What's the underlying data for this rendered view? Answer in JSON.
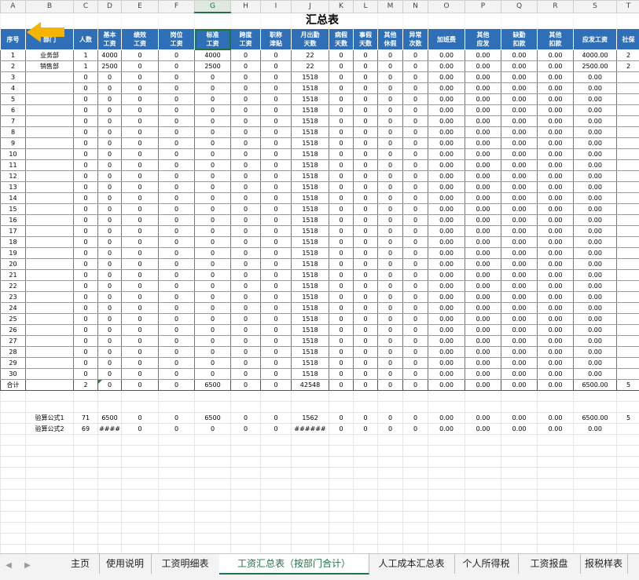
{
  "column_headers": [
    "A",
    "B",
    "C",
    "D",
    "E",
    "F",
    "G",
    "H",
    "I",
    "J",
    "K",
    "L",
    "M",
    "N",
    "O",
    "P",
    "Q",
    "R",
    "S",
    "T"
  ],
  "selected_column": "G",
  "sheet_title": "汇总表",
  "table_headers": [
    "序号",
    "部门",
    "人数",
    "基本\n工资",
    "绩效\n工资",
    "岗位\n工资",
    "标准\n工资",
    "跨度\n工资",
    "职称\n津贴",
    "月出勤\n天数",
    "病假\n天数",
    "事假\n天数",
    "其他\n休假",
    "异常\n次数",
    "加班费",
    "其他\n应发",
    "缺勤\n扣款",
    "其他\n扣款",
    "应发工资",
    "社保"
  ],
  "rows": [
    [
      "1",
      "业务部",
      "1",
      "4000",
      "0",
      "0",
      "4000",
      "0",
      "0",
      "22",
      "0",
      "0",
      "0",
      "0",
      "0.00",
      "0.00",
      "0.00",
      "0.00",
      "4000.00",
      "2"
    ],
    [
      "2",
      "销售部",
      "1",
      "2500",
      "0",
      "0",
      "2500",
      "0",
      "0",
      "22",
      "0",
      "0",
      "0",
      "0",
      "0.00",
      "0.00",
      "0.00",
      "0.00",
      "2500.00",
      "2"
    ],
    [
      "3",
      "",
      "0",
      "0",
      "0",
      "0",
      "0",
      "0",
      "0",
      "1518",
      "0",
      "0",
      "0",
      "0",
      "0.00",
      "0.00",
      "0.00",
      "0.00",
      "0.00",
      ""
    ],
    [
      "4",
      "",
      "0",
      "0",
      "0",
      "0",
      "0",
      "0",
      "0",
      "1518",
      "0",
      "0",
      "0",
      "0",
      "0.00",
      "0.00",
      "0.00",
      "0.00",
      "0.00",
      ""
    ],
    [
      "5",
      "",
      "0",
      "0",
      "0",
      "0",
      "0",
      "0",
      "0",
      "1518",
      "0",
      "0",
      "0",
      "0",
      "0.00",
      "0.00",
      "0.00",
      "0.00",
      "0.00",
      ""
    ],
    [
      "6",
      "",
      "0",
      "0",
      "0",
      "0",
      "0",
      "0",
      "0",
      "1518",
      "0",
      "0",
      "0",
      "0",
      "0.00",
      "0.00",
      "0.00",
      "0.00",
      "0.00",
      ""
    ],
    [
      "7",
      "",
      "0",
      "0",
      "0",
      "0",
      "0",
      "0",
      "0",
      "1518",
      "0",
      "0",
      "0",
      "0",
      "0.00",
      "0.00",
      "0.00",
      "0.00",
      "0.00",
      ""
    ],
    [
      "8",
      "",
      "0",
      "0",
      "0",
      "0",
      "0",
      "0",
      "0",
      "1518",
      "0",
      "0",
      "0",
      "0",
      "0.00",
      "0.00",
      "0.00",
      "0.00",
      "0.00",
      ""
    ],
    [
      "9",
      "",
      "0",
      "0",
      "0",
      "0",
      "0",
      "0",
      "0",
      "1518",
      "0",
      "0",
      "0",
      "0",
      "0.00",
      "0.00",
      "0.00",
      "0.00",
      "0.00",
      ""
    ],
    [
      "10",
      "",
      "0",
      "0",
      "0",
      "0",
      "0",
      "0",
      "0",
      "1518",
      "0",
      "0",
      "0",
      "0",
      "0.00",
      "0.00",
      "0.00",
      "0.00",
      "0.00",
      ""
    ],
    [
      "11",
      "",
      "0",
      "0",
      "0",
      "0",
      "0",
      "0",
      "0",
      "1518",
      "0",
      "0",
      "0",
      "0",
      "0.00",
      "0.00",
      "0.00",
      "0.00",
      "0.00",
      ""
    ],
    [
      "12",
      "",
      "0",
      "0",
      "0",
      "0",
      "0",
      "0",
      "0",
      "1518",
      "0",
      "0",
      "0",
      "0",
      "0.00",
      "0.00",
      "0.00",
      "0.00",
      "0.00",
      ""
    ],
    [
      "13",
      "",
      "0",
      "0",
      "0",
      "0",
      "0",
      "0",
      "0",
      "1518",
      "0",
      "0",
      "0",
      "0",
      "0.00",
      "0.00",
      "0.00",
      "0.00",
      "0.00",
      ""
    ],
    [
      "14",
      "",
      "0",
      "0",
      "0",
      "0",
      "0",
      "0",
      "0",
      "1518",
      "0",
      "0",
      "0",
      "0",
      "0.00",
      "0.00",
      "0.00",
      "0.00",
      "0.00",
      ""
    ],
    [
      "15",
      "",
      "0",
      "0",
      "0",
      "0",
      "0",
      "0",
      "0",
      "1518",
      "0",
      "0",
      "0",
      "0",
      "0.00",
      "0.00",
      "0.00",
      "0.00",
      "0.00",
      ""
    ],
    [
      "16",
      "",
      "0",
      "0",
      "0",
      "0",
      "0",
      "0",
      "0",
      "1518",
      "0",
      "0",
      "0",
      "0",
      "0.00",
      "0.00",
      "0.00",
      "0.00",
      "0.00",
      ""
    ],
    [
      "17",
      "",
      "0",
      "0",
      "0",
      "0",
      "0",
      "0",
      "0",
      "1518",
      "0",
      "0",
      "0",
      "0",
      "0.00",
      "0.00",
      "0.00",
      "0.00",
      "0.00",
      ""
    ],
    [
      "18",
      "",
      "0",
      "0",
      "0",
      "0",
      "0",
      "0",
      "0",
      "1518",
      "0",
      "0",
      "0",
      "0",
      "0.00",
      "0.00",
      "0.00",
      "0.00",
      "0.00",
      ""
    ],
    [
      "19",
      "",
      "0",
      "0",
      "0",
      "0",
      "0",
      "0",
      "0",
      "1518",
      "0",
      "0",
      "0",
      "0",
      "0.00",
      "0.00",
      "0.00",
      "0.00",
      "0.00",
      ""
    ],
    [
      "20",
      "",
      "0",
      "0",
      "0",
      "0",
      "0",
      "0",
      "0",
      "1518",
      "0",
      "0",
      "0",
      "0",
      "0.00",
      "0.00",
      "0.00",
      "0.00",
      "0.00",
      ""
    ],
    [
      "21",
      "",
      "0",
      "0",
      "0",
      "0",
      "0",
      "0",
      "0",
      "1518",
      "0",
      "0",
      "0",
      "0",
      "0.00",
      "0.00",
      "0.00",
      "0.00",
      "0.00",
      ""
    ],
    [
      "22",
      "",
      "0",
      "0",
      "0",
      "0",
      "0",
      "0",
      "0",
      "1518",
      "0",
      "0",
      "0",
      "0",
      "0.00",
      "0.00",
      "0.00",
      "0.00",
      "0.00",
      ""
    ],
    [
      "23",
      "",
      "0",
      "0",
      "0",
      "0",
      "0",
      "0",
      "0",
      "1518",
      "0",
      "0",
      "0",
      "0",
      "0.00",
      "0.00",
      "0.00",
      "0.00",
      "0.00",
      ""
    ],
    [
      "24",
      "",
      "0",
      "0",
      "0",
      "0",
      "0",
      "0",
      "0",
      "1518",
      "0",
      "0",
      "0",
      "0",
      "0.00",
      "0.00",
      "0.00",
      "0.00",
      "0.00",
      ""
    ],
    [
      "25",
      "",
      "0",
      "0",
      "0",
      "0",
      "0",
      "0",
      "0",
      "1518",
      "0",
      "0",
      "0",
      "0",
      "0.00",
      "0.00",
      "0.00",
      "0.00",
      "0.00",
      ""
    ],
    [
      "26",
      "",
      "0",
      "0",
      "0",
      "0",
      "0",
      "0",
      "0",
      "1518",
      "0",
      "0",
      "0",
      "0",
      "0.00",
      "0.00",
      "0.00",
      "0.00",
      "0.00",
      ""
    ],
    [
      "27",
      "",
      "0",
      "0",
      "0",
      "0",
      "0",
      "0",
      "0",
      "1518",
      "0",
      "0",
      "0",
      "0",
      "0.00",
      "0.00",
      "0.00",
      "0.00",
      "0.00",
      ""
    ],
    [
      "28",
      "",
      "0",
      "0",
      "0",
      "0",
      "0",
      "0",
      "0",
      "1518",
      "0",
      "0",
      "0",
      "0",
      "0.00",
      "0.00",
      "0.00",
      "0.00",
      "0.00",
      ""
    ],
    [
      "29",
      "",
      "0",
      "0",
      "0",
      "0",
      "0",
      "0",
      "0",
      "1518",
      "0",
      "0",
      "0",
      "0",
      "0.00",
      "0.00",
      "0.00",
      "0.00",
      "0.00",
      ""
    ],
    [
      "30",
      "",
      "0",
      "0",
      "0",
      "0",
      "0",
      "0",
      "0",
      "1518",
      "0",
      "0",
      "0",
      "0",
      "0.00",
      "0.00",
      "0.00",
      "0.00",
      "0.00",
      ""
    ]
  ],
  "total_row": [
    "合计",
    "",
    "2",
    "0",
    "0",
    "0",
    "6500",
    "0",
    "0",
    "42548",
    "0",
    "0",
    "0",
    "0",
    "0.00",
    "0.00",
    "0.00",
    "0.00",
    "6500.00",
    "5"
  ],
  "verify_rows": [
    [
      "",
      "验算公式1",
      "71",
      "6500",
      "0",
      "0",
      "6500",
      "0",
      "0",
      "1562",
      "0",
      "0",
      "0",
      "0",
      "0.00",
      "0.00",
      "0.00",
      "0.00",
      "6500.00",
      "5"
    ],
    [
      "",
      "验算公式2",
      "69",
      "####",
      "0",
      "0",
      "0",
      "0",
      "0",
      "######",
      "0",
      "0",
      "0",
      "0",
      "0.00",
      "0.00",
      "0.00",
      "0.00",
      "0.00",
      ""
    ]
  ],
  "red_cells": [
    [
      1,
      2
    ],
    [
      1,
      3
    ],
    [
      1,
      9
    ]
  ],
  "colors": {
    "header_blue": "#2f6fb8",
    "active_green": "#217346",
    "arrow_orange": "#f4b400",
    "error_red": "#c00000"
  },
  "icons": {
    "back": "arrow-left-icon",
    "nav_prev": "triangle-left-icon",
    "nav_next": "triangle-right-icon"
  },
  "sheet_tabs": [
    "主页",
    "使用说明",
    "工资明细表",
    "工资汇总表（按部门合计）",
    "人工成本汇总表",
    "个人所得税",
    "工资报盘",
    "报税样表"
  ],
  "active_tab": 3
}
